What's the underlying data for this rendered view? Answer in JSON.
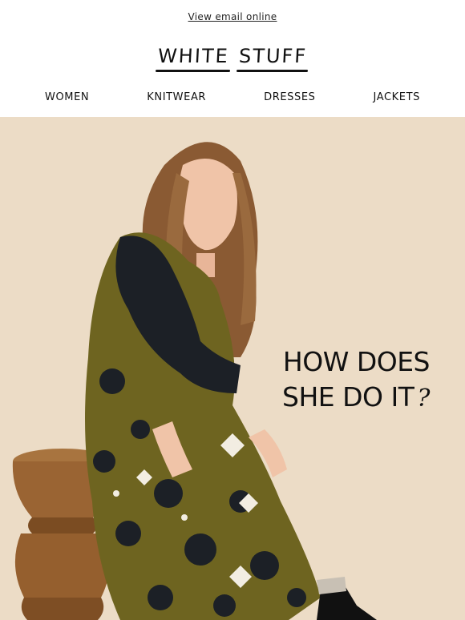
{
  "header": {
    "view_online": "View email online",
    "logo_word_1": "WHITE",
    "logo_word_2": "STUFF"
  },
  "nav": {
    "items": [
      {
        "label": "WOMEN"
      },
      {
        "label": "KNITWEAR"
      },
      {
        "label": "DRESSES"
      },
      {
        "label": "JACKETS"
      }
    ]
  },
  "hero": {
    "headline_line1": "HOW DOES",
    "headline_line2": "SHE DO IT",
    "headline_mark": "?",
    "background_color": "#ecdcc6",
    "dress_color": "#6e6420",
    "print_color": "#1c2026"
  }
}
